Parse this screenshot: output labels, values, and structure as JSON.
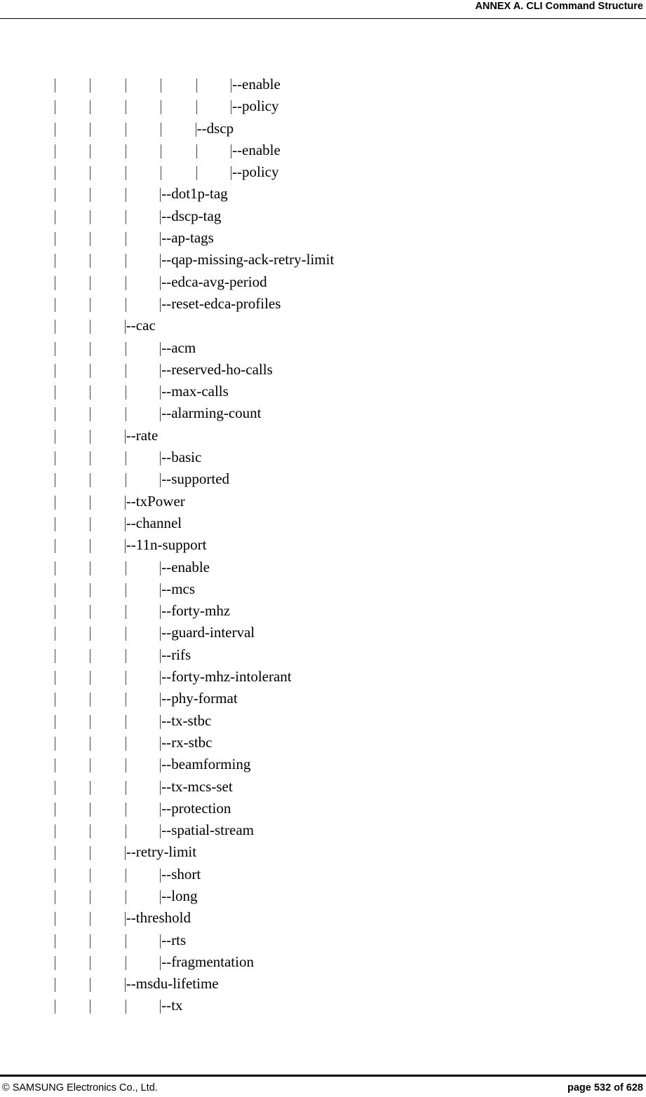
{
  "header": {
    "title": "ANNEX A. CLI Command Structure"
  },
  "tree": {
    "branch_prefix": "-- ",
    "rows": [
      {
        "depth": 5,
        "label": "enable"
      },
      {
        "depth": 5,
        "label": "policy"
      },
      {
        "depth": 4,
        "label": "dscp"
      },
      {
        "depth": 5,
        "label": "enable"
      },
      {
        "depth": 5,
        "label": "policy"
      },
      {
        "depth": 3,
        "label": "dot1p-tag"
      },
      {
        "depth": 3,
        "label": "dscp-tag"
      },
      {
        "depth": 3,
        "label": "ap-tags"
      },
      {
        "depth": 3,
        "label": "qap-missing-ack-retry-limit"
      },
      {
        "depth": 3,
        "label": "edca-avg-period"
      },
      {
        "depth": 3,
        "label": "reset-edca-profiles"
      },
      {
        "depth": 2,
        "label": "cac"
      },
      {
        "depth": 3,
        "label": "acm"
      },
      {
        "depth": 3,
        "label": "reserved-ho-calls"
      },
      {
        "depth": 3,
        "label": "max-calls"
      },
      {
        "depth": 3,
        "label": "alarming-count"
      },
      {
        "depth": 2,
        "label": "rate"
      },
      {
        "depth": 3,
        "label": "basic"
      },
      {
        "depth": 3,
        "label": "supported"
      },
      {
        "depth": 2,
        "label": "txPower"
      },
      {
        "depth": 2,
        "label": "channel"
      },
      {
        "depth": 2,
        "label": "11n-support"
      },
      {
        "depth": 3,
        "label": "enable"
      },
      {
        "depth": 3,
        "label": "mcs"
      },
      {
        "depth": 3,
        "label": "forty-mhz"
      },
      {
        "depth": 3,
        "label": "guard-interval"
      },
      {
        "depth": 3,
        "label": "rifs"
      },
      {
        "depth": 3,
        "label": "forty-mhz-intolerant"
      },
      {
        "depth": 3,
        "label": "phy-format"
      },
      {
        "depth": 3,
        "label": "tx-stbc"
      },
      {
        "depth": 3,
        "label": "rx-stbc"
      },
      {
        "depth": 3,
        "label": "beamforming"
      },
      {
        "depth": 3,
        "label": "tx-mcs-set"
      },
      {
        "depth": 3,
        "label": "protection"
      },
      {
        "depth": 3,
        "label": "spatial-stream"
      },
      {
        "depth": 2,
        "label": "retry-limit"
      },
      {
        "depth": 3,
        "label": "short"
      },
      {
        "depth": 3,
        "label": "long"
      },
      {
        "depth": 2,
        "label": "threshold"
      },
      {
        "depth": 3,
        "label": "rts"
      },
      {
        "depth": 3,
        "label": "fragmentation"
      },
      {
        "depth": 2,
        "label": "msdu-lifetime"
      },
      {
        "depth": 3,
        "label": "tx"
      }
    ]
  },
  "footer": {
    "copyright": "© SAMSUNG Electronics Co., Ltd.",
    "page_label": "page 532 of 628"
  }
}
